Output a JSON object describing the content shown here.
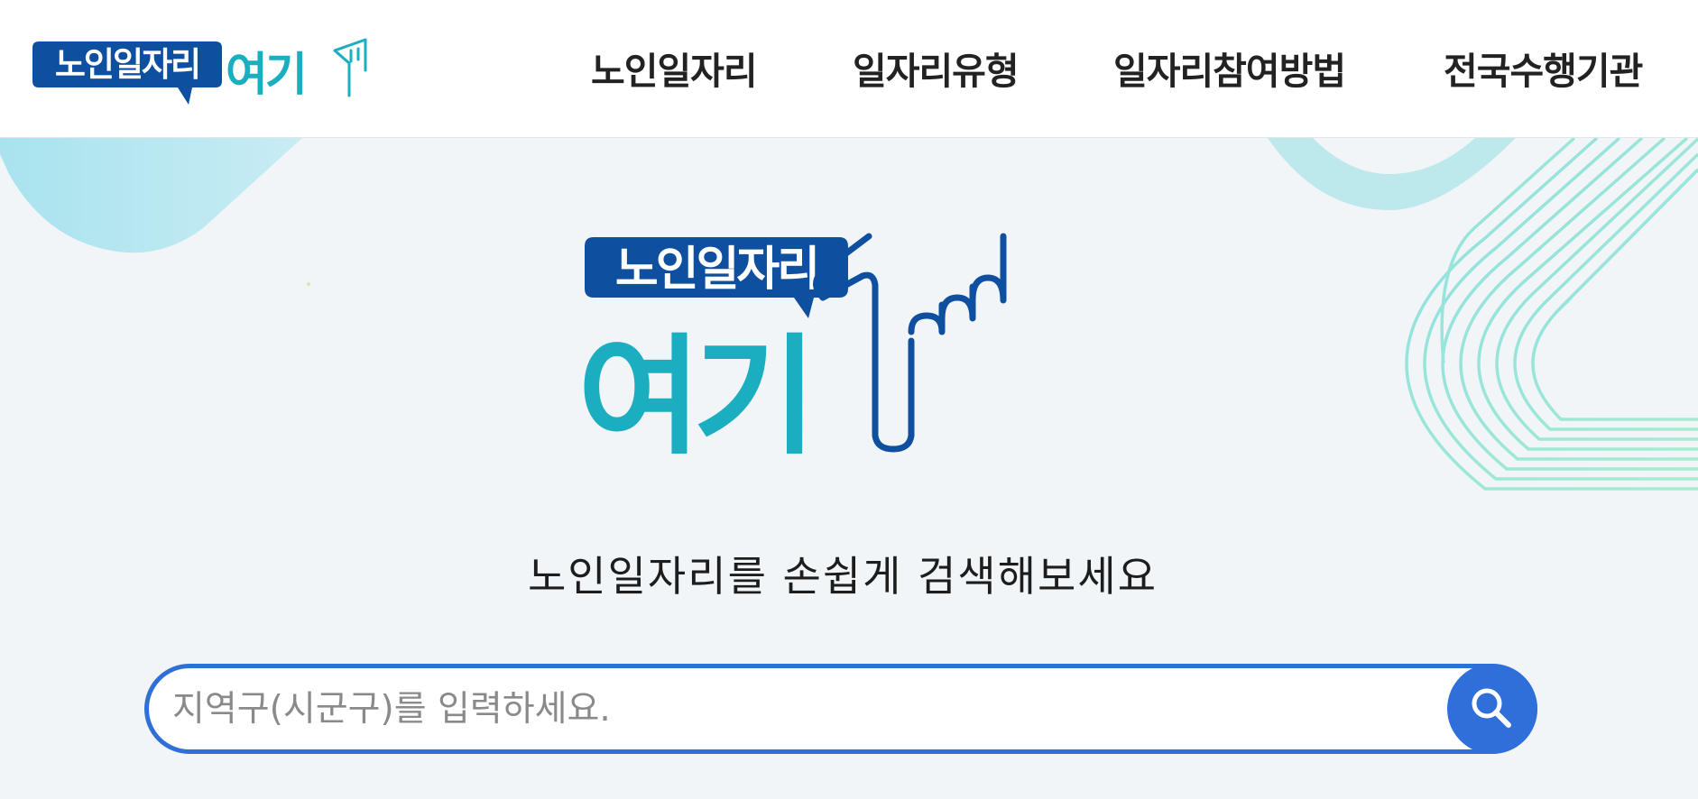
{
  "header": {
    "logo": {
      "badge_text": "노인일자리",
      "accent_text": "여기"
    },
    "nav": [
      {
        "label": "노인일자리"
      },
      {
        "label": "일자리유형"
      },
      {
        "label": "일자리참여방법"
      },
      {
        "label": "전국수행기관"
      }
    ]
  },
  "hero": {
    "logo": {
      "badge_text": "노인일자리",
      "accent_text": "여기"
    },
    "subtitle": "노인일자리를 손쉽게 검색해보세요"
  },
  "search": {
    "placeholder": "지역구(시군구)를 입력하세요.",
    "button_icon": "search-icon"
  },
  "colors": {
    "brand_navy": "#0f4fa0",
    "brand_teal": "#1aaec0",
    "search_blue": "#2e6fd8",
    "background": "#f2f5f8"
  }
}
